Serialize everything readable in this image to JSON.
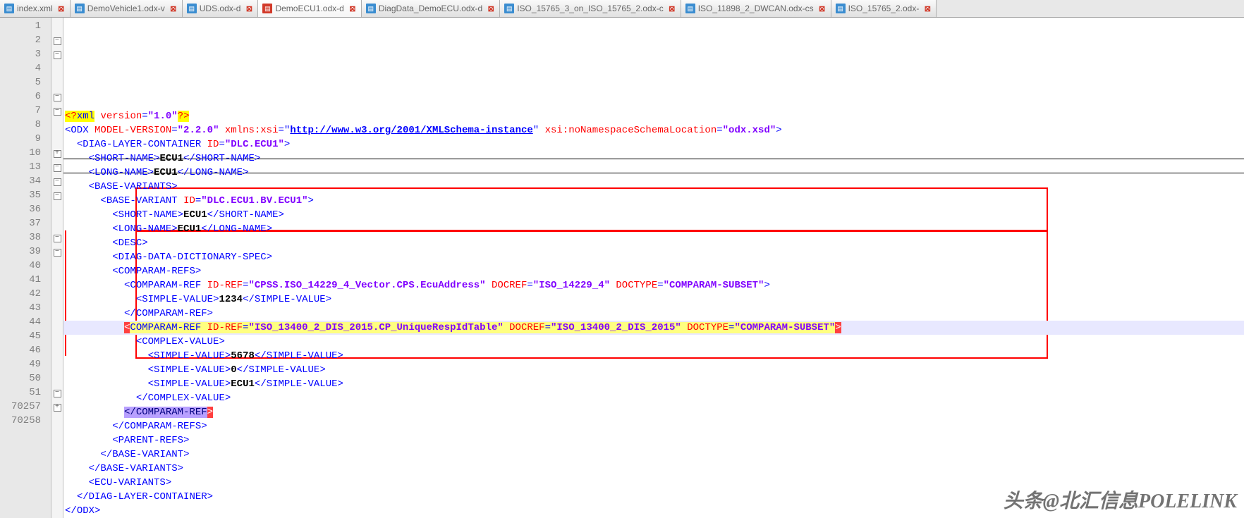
{
  "tabs": [
    {
      "label": "index.xml",
      "active": false
    },
    {
      "label": "DemoVehicle1.odx-v",
      "active": false
    },
    {
      "label": "UDS.odx-d",
      "active": false
    },
    {
      "label": "DemoECU1.odx-d",
      "active": true
    },
    {
      "label": "DiagData_DemoECU.odx-d",
      "active": false
    },
    {
      "label": "ISO_15765_3_on_ISO_15765_2.odx-c",
      "active": false
    },
    {
      "label": "ISO_11898_2_DWCAN.odx-cs",
      "active": false
    },
    {
      "label": "ISO_15765_2.odx-",
      "active": false
    }
  ],
  "line_numbers": [
    "1",
    "2",
    "3",
    "4",
    "5",
    "6",
    "7",
    "8",
    "9",
    "10",
    "13",
    "34",
    "35",
    "36",
    "37",
    "38",
    "39",
    "40",
    "41",
    "42",
    "43",
    "44",
    "45",
    "46",
    "49",
    "50",
    "51",
    "70257",
    "70258"
  ],
  "fold_markers": [
    "",
    "-",
    "-",
    "",
    "",
    "-",
    "-",
    "",
    "",
    "+",
    "-",
    "-",
    "-",
    "",
    "",
    "-",
    "-",
    "",
    "",
    "",
    "",
    "",
    "",
    "",
    "",
    "",
    "-",
    "+",
    ""
  ],
  "xml": {
    "pi": {
      "open": "<?",
      "name": "xml",
      "attr": "version",
      "val": "1.0",
      "close": "?>"
    },
    "odx": {
      "tag": "ODX",
      "a1": "MODEL-VERSION",
      "v1": "2.2.0",
      "a2": "xmlns:xsi",
      "v2": "http://www.w3.org/2001/XMLSchema-instance",
      "a3": "xsi:noNamespaceSchemaLocation",
      "v3": "odx.xsd"
    },
    "dlc": {
      "tag": "DIAG-LAYER-CONTAINER",
      "a": "ID",
      "v": "DLC.ECU1"
    },
    "short1": {
      "tag": "SHORT-NAME",
      "val": "ECU1"
    },
    "long1": {
      "tag": "LONG-NAME",
      "val": "ECU1"
    },
    "bvs": {
      "tag": "BASE-VARIANTS"
    },
    "bv": {
      "tag": "BASE-VARIANT",
      "a": "ID",
      "v": "DLC.ECU1.BV.ECU1"
    },
    "short2": {
      "tag": "SHORT-NAME",
      "val": "ECU1"
    },
    "long2": {
      "tag": "LONG-NAME",
      "val": "ECU1"
    },
    "desc": {
      "tag": "DESC"
    },
    "dds": {
      "tag": "DIAG-DATA-DICTIONARY-SPEC"
    },
    "crs": {
      "tag": "COMPARAM-REFS"
    },
    "cr1": {
      "tag": "COMPARAM-REF",
      "a1": "ID-REF",
      "v1": "CPSS.ISO_14229_4_Vector.CPS.EcuAddress",
      "a2": "DOCREF",
      "v2": "ISO_14229_4",
      "a3": "DOCTYPE",
      "v3": "COMPARAM-SUBSET"
    },
    "sv1": {
      "tag": "SIMPLE-VALUE",
      "val": "1234"
    },
    "cr2": {
      "tag": "COMPARAM-REF",
      "a1": "ID-REF",
      "v1": "ISO_13400_2_DIS_2015.CP_UniqueRespIdTable",
      "a2": "DOCREF",
      "v2": "ISO_13400_2_DIS_2015",
      "a3": "DOCTYPE",
      "v3": "COMPARAM-SUBSET"
    },
    "cv": {
      "tag": "COMPLEX-VALUE"
    },
    "sv2": {
      "tag": "SIMPLE-VALUE",
      "val": "5678"
    },
    "sv3": {
      "tag": "SIMPLE-VALUE",
      "val": "0"
    },
    "sv4": {
      "tag": "SIMPLE-VALUE",
      "val": "ECU1"
    },
    "pr": {
      "tag": "PARENT-REFS"
    },
    "ev": {
      "tag": "ECU-VARIANTS"
    }
  },
  "watermark": "头条@北汇信息POLELINK"
}
